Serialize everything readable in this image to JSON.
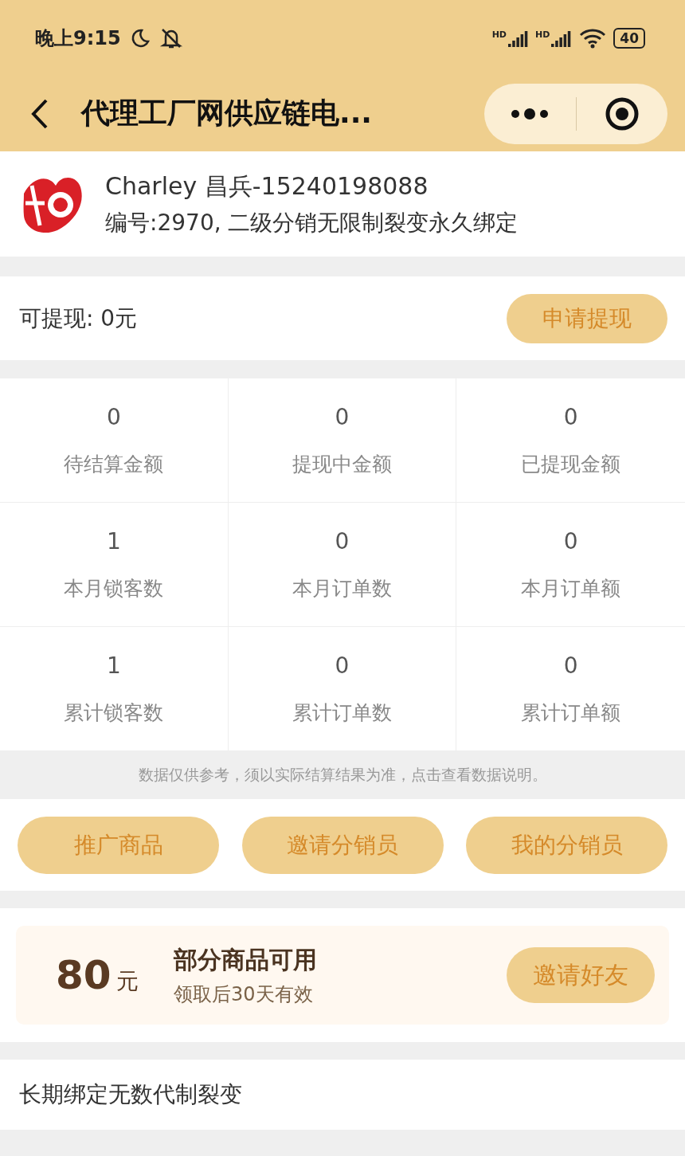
{
  "status_bar": {
    "time": "晚上9:15",
    "signal_labels": [
      "HD",
      "HD"
    ],
    "battery": "40"
  },
  "nav": {
    "title": "代理工厂网供应链电..."
  },
  "profile": {
    "name": "Charley 昌兵-15240198088",
    "info": "编号:2970, 二级分销无限制裂变永久绑定"
  },
  "withdraw": {
    "label": "可提现: 0元",
    "button": "申请提现"
  },
  "stats": [
    {
      "value": "0",
      "label": "待结算金额"
    },
    {
      "value": "0",
      "label": "提现中金额"
    },
    {
      "value": "0",
      "label": "已提现金额"
    },
    {
      "value": "1",
      "label": "本月锁客数"
    },
    {
      "value": "0",
      "label": "本月订单数"
    },
    {
      "value": "0",
      "label": "本月订单额"
    },
    {
      "value": "1",
      "label": "累计锁客数"
    },
    {
      "value": "0",
      "label": "累计订单数"
    },
    {
      "value": "0",
      "label": "累计订单额"
    }
  ],
  "note": "数据仅供参考，须以实际结算结果为准，点击查看数据说明。",
  "actions": [
    "推广商品",
    "邀请分销员",
    "我的分销员"
  ],
  "coupon": {
    "amount": "80",
    "unit": "元",
    "title": "部分商品可用",
    "subtitle": "领取后30天有效",
    "button": "邀请好友"
  },
  "footer": {
    "text": "长期绑定无数代制裂变"
  }
}
